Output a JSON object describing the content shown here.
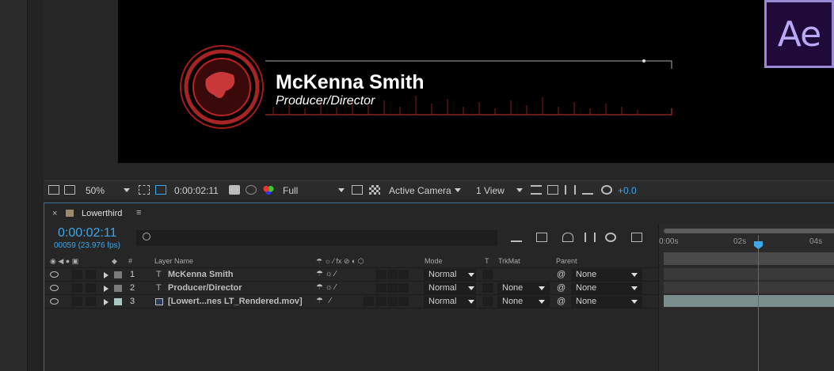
{
  "app": {
    "logo_text": "Ae"
  },
  "composition": {
    "title_text": "McKenna Smith",
    "subtitle_text": "Producer/Director"
  },
  "viewer_toolbar": {
    "zoom": "50%",
    "timecode": "0:00:02:11",
    "resolution": "Full",
    "camera": "Active Camera",
    "view": "1 View",
    "exposure": "+0.0"
  },
  "timeline": {
    "comp_name": "Lowerthird",
    "current_time": "0:00:02:11",
    "frame_info": "00059 (23.976 fps)",
    "columns": {
      "number": "#",
      "layer_name": "Layer Name",
      "mode": "Mode",
      "t": "T",
      "trkmat": "TrkMat",
      "parent": "Parent"
    },
    "ruler": {
      "labels": [
        "0:00s",
        "02s",
        "04s"
      ]
    },
    "layers": [
      {
        "index": "1",
        "name": "McKenna Smith",
        "type": "text",
        "label_color": "#7a7a7a",
        "mode": "Normal",
        "trkmat": "",
        "parent": "None"
      },
      {
        "index": "2",
        "name": "Producer/Director",
        "type": "text",
        "label_color": "#7a7a7a",
        "mode": "Normal",
        "trkmat": "None",
        "parent": "None"
      },
      {
        "index": "3",
        "name": "[Lowert...nes LT_Rendered.mov]",
        "type": "footage",
        "label_color": "#a9c7c2",
        "mode": "Normal",
        "trkmat": "None",
        "parent": "None"
      }
    ]
  },
  "colors": {
    "accent": "#3fa6e8",
    "playhead": "#d43b30",
    "logo": "#9b8bd6"
  }
}
